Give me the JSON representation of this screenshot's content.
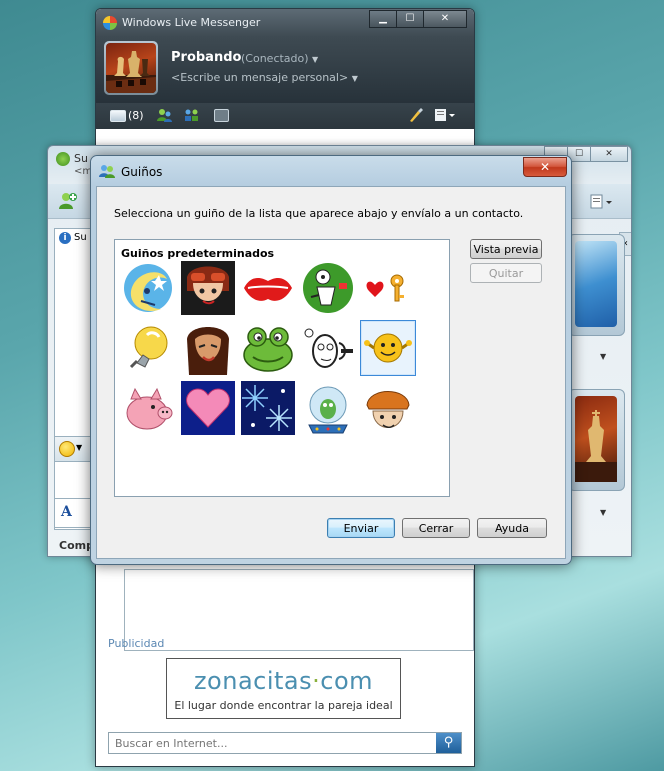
{
  "messenger": {
    "title": "Windows Live Messenger",
    "user_name": "Probando",
    "status": "(Conectado)",
    "personal_message": "<Escribe un mensaje personal>",
    "mail_count": "(8)",
    "advertising_label": "Publicidad",
    "ad": {
      "brand_part1": "zonacitas",
      "brand_dot": "·",
      "brand_part2": "com",
      "tagline": "El lugar donde encontrar la pareja ideal"
    },
    "search_placeholder": "Buscar en Internet..."
  },
  "conversation": {
    "title_partial": "Su",
    "subtitle_partial": "<m",
    "info_label": "Su",
    "compose_label": "Comp"
  },
  "dialog": {
    "title": "Guiños",
    "close_glyph": "✕",
    "instruction": "Selecciona un guiño de la lista que aparece abajo y envíalo a un contacto.",
    "group_title": "Guiños predeterminados",
    "preview_button": "Vista previa",
    "remove_button": "Quitar",
    "send_button": "Enviar",
    "close_button": "Cerrar",
    "help_button": "Ayuda",
    "winks": [
      {
        "name": "moon"
      },
      {
        "name": "aviator-girl"
      },
      {
        "name": "kiss-lips"
      },
      {
        "name": "green-cartoon"
      },
      {
        "name": "heart-key"
      },
      {
        "name": "lightbulb"
      },
      {
        "name": "girl-face"
      },
      {
        "name": "frog"
      },
      {
        "name": "face-sketch"
      },
      {
        "name": "smiley",
        "selected": true
      },
      {
        "name": "pig"
      },
      {
        "name": "heart"
      },
      {
        "name": "sparkles"
      },
      {
        "name": "snow-globe"
      },
      {
        "name": "boy-cap"
      }
    ]
  },
  "colors": {
    "accent": "#3c89d8",
    "close_red": "#c0381c"
  }
}
